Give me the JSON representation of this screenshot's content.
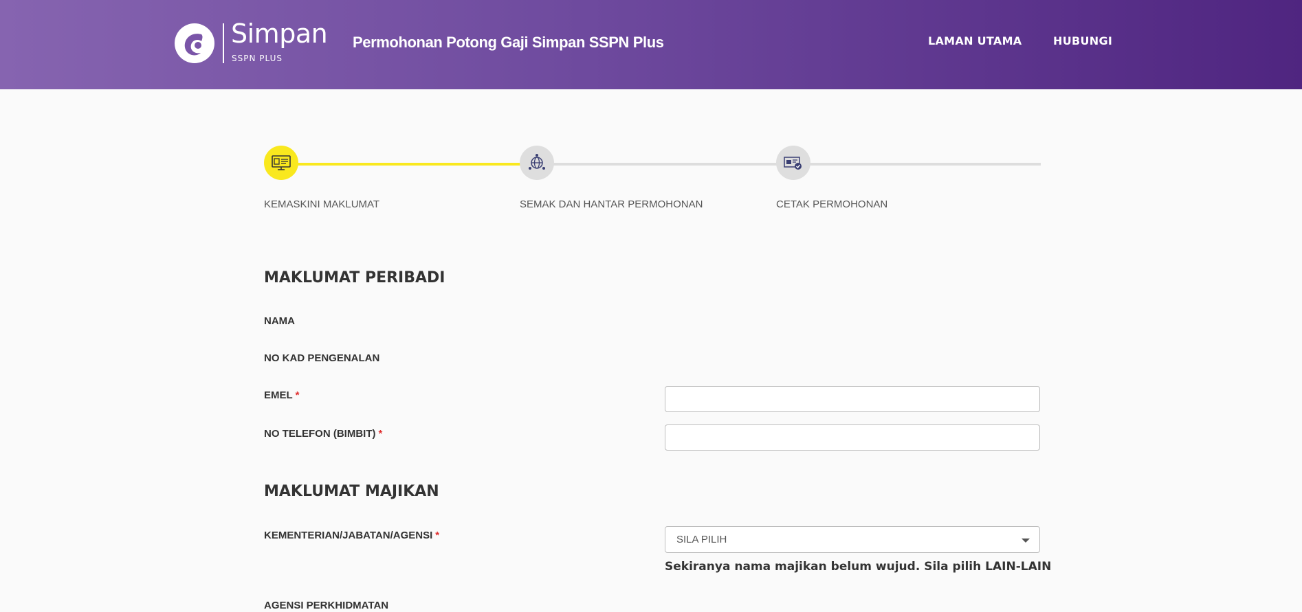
{
  "header": {
    "logo_text": "Simpan",
    "logo_subtext": "SSPN PLUS",
    "title": "Permohonan Potong Gaji Simpan SSPN Plus",
    "nav": [
      "LAMAN UTAMA",
      "HUBUNGI"
    ]
  },
  "stepper": {
    "steps": [
      {
        "label": "KEMASKINI MAKLUMAT",
        "icon": "monitor-form-icon",
        "status": "active"
      },
      {
        "label": "SEMAK DAN HANTAR PERMOHONAN",
        "icon": "globe-send-icon",
        "status": "pending"
      },
      {
        "label": "CETAK PERMOHONAN",
        "icon": "certificate-print-icon",
        "status": "pending"
      }
    ]
  },
  "personal": {
    "title": "MAKLUMAT PERIBADI",
    "name_label": "NAMA",
    "id_label": "NO KAD PENGENALAN",
    "email_label": "EMEL",
    "email_value": "",
    "phone_label": "NO TELEFON (BIMBIT)",
    "phone_value": "",
    "required_mark": "*"
  },
  "employer": {
    "title": "MAKLUMAT MAJIKAN",
    "ministry_label": "KEMENTERIAN/JABATAN/AGENSI",
    "ministry_selected": "SILA PILIH",
    "hint": "Sekiranya nama majikan belum wujud. Sila pilih LAIN-LAIN",
    "agency_label": "AGENSI PERKHIDMATAN"
  },
  "colors": {
    "header_gradient_start": "#8664b0",
    "header_gradient_end": "#4f2580",
    "step_active": "#f9e81e",
    "step_inactive": "#dedede",
    "required": "#e03030"
  }
}
